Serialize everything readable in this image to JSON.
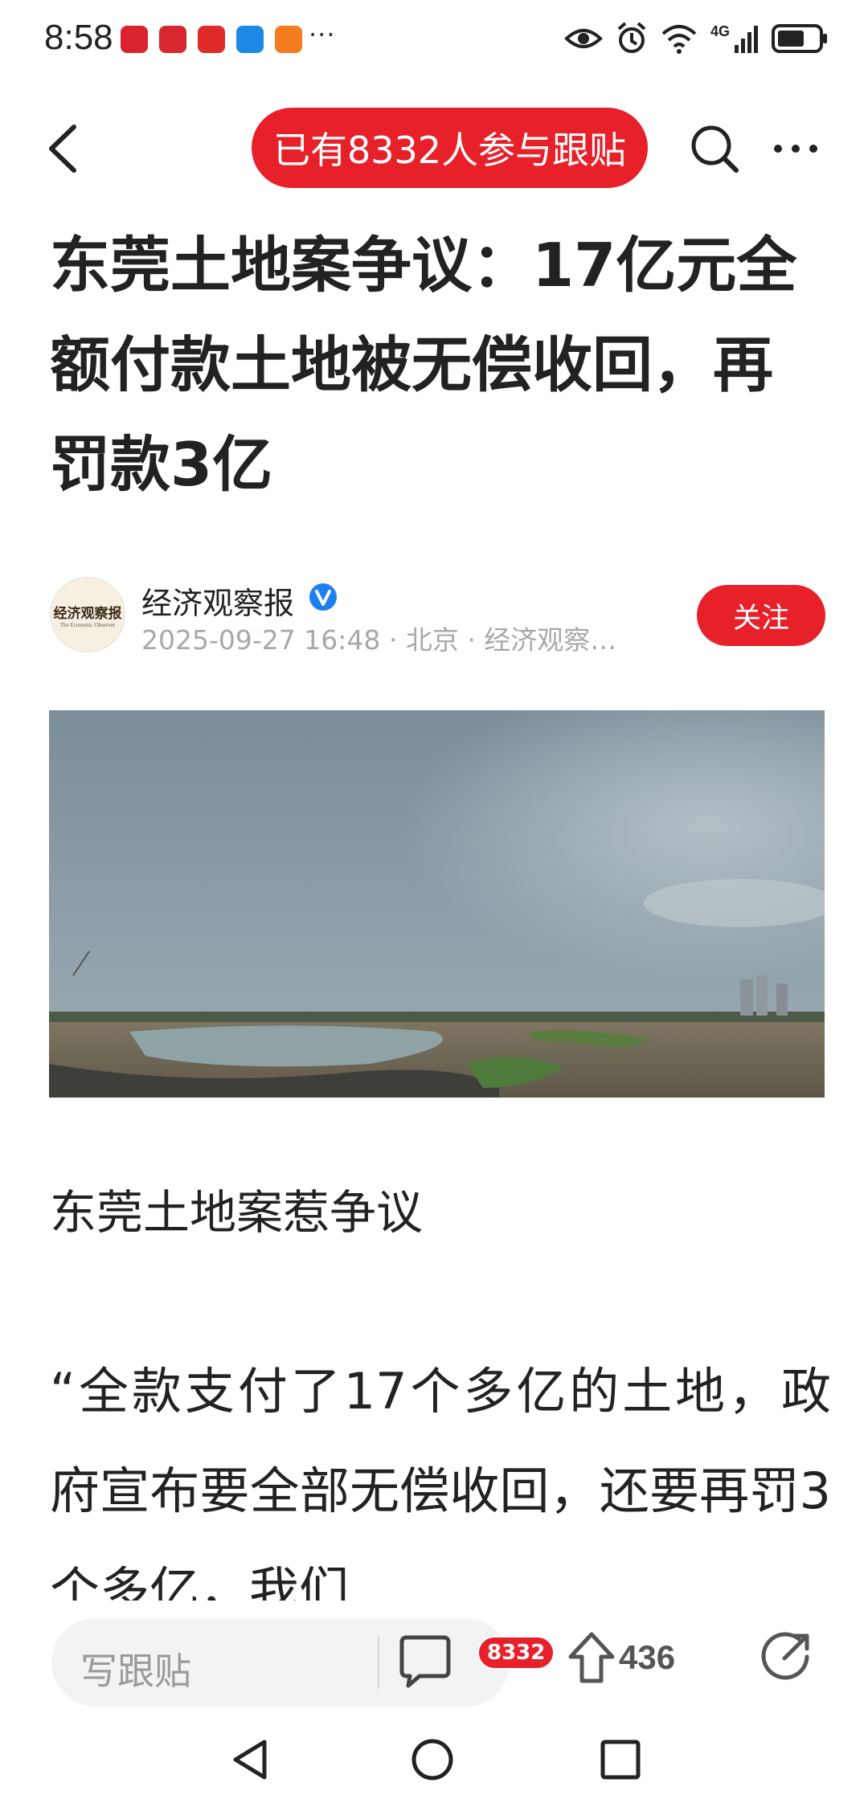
{
  "status_bar": {
    "time": "8:58",
    "app_icons": [
      {
        "name": "huawei-app-icon",
        "color": "#d9232e"
      },
      {
        "name": "news-app-icon",
        "color": "#d7282f"
      },
      {
        "name": "netease-app-icon",
        "color": "#e02a2a"
      },
      {
        "name": "security-app-icon",
        "color": "#1e88e5"
      },
      {
        "name": "orange-app-icon",
        "color": "#f57c1f"
      }
    ],
    "more": "···",
    "network": "4G"
  },
  "nav": {
    "participants_pill": "已有8332人参与跟贴"
  },
  "article": {
    "title": "东莞土地案争议：17亿元全额付款土地被无偿收回，再罚款3亿",
    "author": {
      "name": "经济观察报",
      "avatar_text_cn": "经济观察报",
      "avatar_text_en": "The Economic Observer",
      "meta": "2025-09-27 16:48 · 北京 · 经济观察…",
      "follow_label": "关注"
    },
    "subheading": "东莞土地案惹争议",
    "body": "“全款支付了17个多亿的土地，政府宣布要全部无偿收回，还要再罚3个多亿，我们"
  },
  "bottom_bar": {
    "comment_placeholder": "写跟贴",
    "comment_count": "8332",
    "upvote_count": "436"
  },
  "colors": {
    "accent": "#e8202a",
    "meta_gray": "#a8a8a8"
  }
}
